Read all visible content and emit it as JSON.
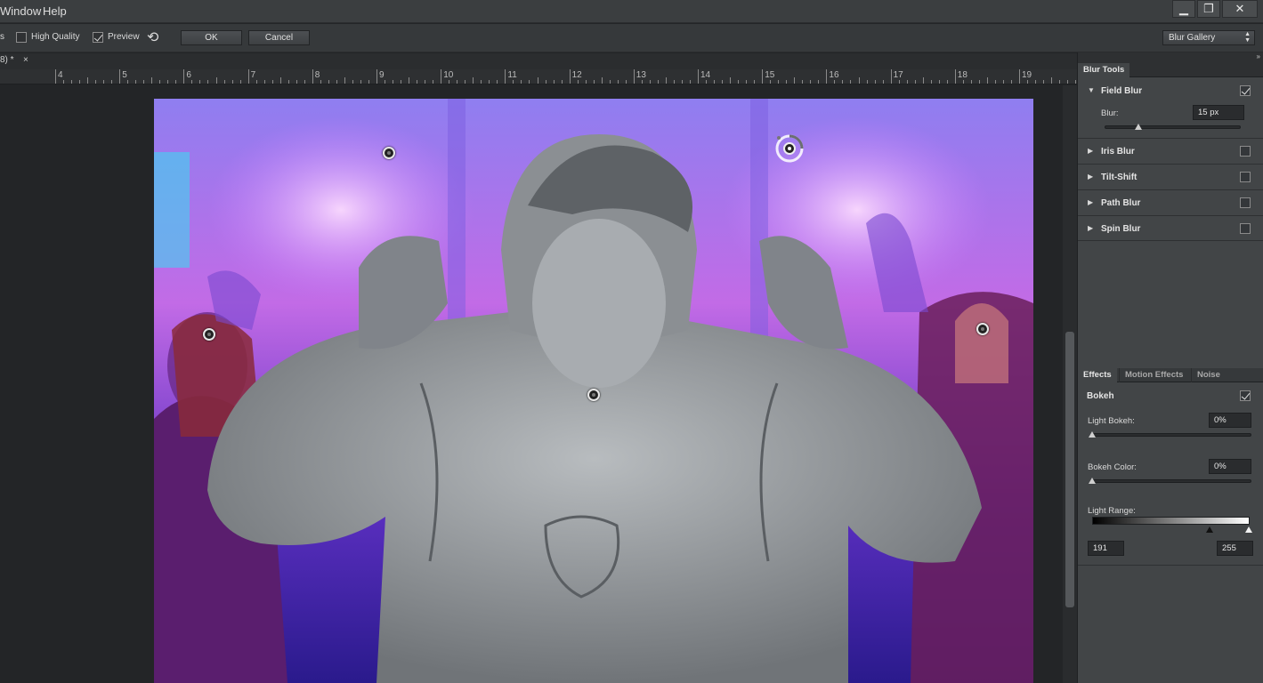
{
  "menu": {
    "window": "Window",
    "help": "Help"
  },
  "window_controls": {
    "minimize": "▁",
    "restore": "❐",
    "close": "✕"
  },
  "options": {
    "partial_label": "s",
    "high_quality_label": "High Quality",
    "high_quality_checked": false,
    "preview_label": "Preview",
    "preview_checked": true,
    "reset_icon": "⟲",
    "ok_label": "OK",
    "cancel_label": "Cancel",
    "workspace_select": "Blur Gallery",
    "select_arrows": "▲▼"
  },
  "document": {
    "tab_label": "8) *",
    "close": "×"
  },
  "ruler": {
    "labels": [
      "4",
      "5",
      "6",
      "7",
      "8",
      "9",
      "10",
      "11",
      "12",
      "13",
      "14",
      "15",
      "16",
      "17",
      "18",
      "19"
    ]
  },
  "panel": {
    "expand_icon": "»",
    "blur_tools_tab": "Blur Tools",
    "field_blur": {
      "title": "Field Blur",
      "checked": true,
      "blur_label": "Blur:",
      "blur_value": "15 px",
      "blur_fraction": 0.25
    },
    "collapsed_sections": [
      {
        "title": "Iris Blur",
        "checked": false
      },
      {
        "title": "Tilt-Shift",
        "checked": false
      },
      {
        "title": "Path Blur",
        "checked": false
      },
      {
        "title": "Spin Blur",
        "checked": false
      }
    ],
    "effect_tabs": [
      "Effects",
      "Motion Effects",
      "Noise"
    ],
    "bokeh": {
      "title": "Bokeh",
      "checked": true,
      "light_bokeh_label": "Light Bokeh:",
      "light_bokeh_value": "0%",
      "bokeh_color_label": "Bokeh Color:",
      "bokeh_color_value": "0%",
      "light_range_label": "Light Range:",
      "range_low": "191",
      "range_high": "255"
    }
  },
  "colors": {
    "panel_bg": "#424547",
    "canvas_bg": "#232527",
    "accent_purple": "#8a4fe0"
  }
}
